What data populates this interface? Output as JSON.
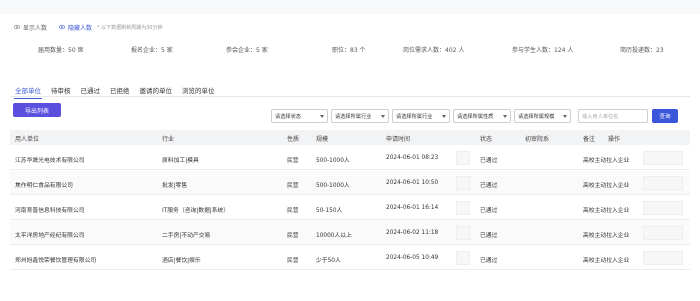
{
  "toggles": [
    {
      "label": "显示人数",
      "active": false
    },
    {
      "label": "隐藏人数",
      "active": true,
      "note": "* 以下数据刷新周期为30分钟"
    }
  ],
  "stats": [
    {
      "label": "届用数量：50 席"
    },
    {
      "label": "报名企业：5 家"
    },
    {
      "label": "参会企业：5 家"
    },
    {
      "label": "职位：83 个"
    },
    {
      "label": "岗位需求人数：402 人"
    },
    {
      "label": "参与学生人数：124 人"
    },
    {
      "label": "简历投递数：23"
    }
  ],
  "tabs": [
    "全部单位",
    "待审核",
    "已通过",
    "已拒绝",
    "邀请的单位",
    "浏览的单位"
  ],
  "export_label": "导出列表",
  "filters": [
    "请选择状态",
    "请选择所属行业",
    "请选择所属行业",
    "请选择所属性质",
    "请选择所属规模"
  ],
  "search": {
    "placeholder": "输入用人单位名"
  },
  "query_label": "查询",
  "columns": [
    "用人单位",
    "行业",
    "性质",
    "规模",
    "申请时间",
    "状态",
    "初审院系",
    "备注",
    "操作"
  ],
  "rows": [
    {
      "company": "江苏华晟光电技术有限公司",
      "industry": "原料加工|模具",
      "nature": "民营",
      "scale": "500-1000人",
      "time": "2024-06-01 08:23",
      "status": "已通过",
      "note": "高校主动拉入企业"
    },
    {
      "company": "焦作明仁食品有限公司",
      "industry": "批发|零售",
      "nature": "民营",
      "scale": "500-1000人",
      "time": "2024-06-01 10:50",
      "status": "已通过",
      "note": "高校主动拉入企业"
    },
    {
      "company": "河南育晋信息科技有限公司",
      "industry": "IT服务（咨询|数据|系统）",
      "nature": "民营",
      "scale": "50-150人",
      "time": "2024-06-01 16:14",
      "status": "已通过",
      "note": "高校主动拉入企业"
    },
    {
      "company": "太平洋房地产经纪有限公司",
      "industry": "二手房|不动产交易",
      "nature": "民营",
      "scale": "10000人以上",
      "time": "2024-06-02 11:18",
      "status": "已通过",
      "note": "高校主动拉入企业"
    },
    {
      "company": "郑州旭鑫悦荣餐饮管理有限公司",
      "industry": "酒店|餐饮|娱乐",
      "nature": "民营",
      "scale": "少于50人",
      "time": "2024-06-05 10:49",
      "status": "已通过",
      "note": "高校主动拉入企业"
    }
  ]
}
